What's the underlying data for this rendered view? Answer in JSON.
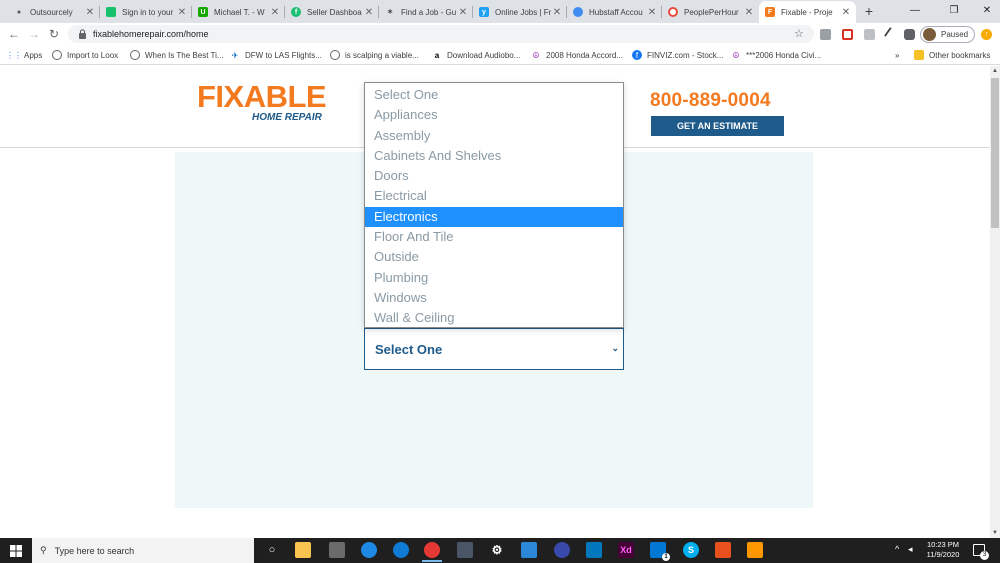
{
  "browser": {
    "tabs": [
      {
        "title": "Outsourcely",
        "icon": "person-icon",
        "color": "#555555"
      },
      {
        "title": "Sign in to your",
        "icon": "green-square-icon",
        "color": "#15c26b"
      },
      {
        "title": "Michael T. - W",
        "icon": "upwork-icon",
        "color": "#14a800"
      },
      {
        "title": "Seller Dashboa",
        "icon": "fiverr-icon",
        "color": "#1dbf73"
      },
      {
        "title": "Find a Job - Gu",
        "icon": "guru-icon",
        "color": "#555555"
      },
      {
        "title": "Online Jobs | Fr",
        "icon": "twitter-bird-icon",
        "color": "#1da1f2"
      },
      {
        "title": "Hubstaff Accou",
        "icon": "hubstaff-icon",
        "color": "#3f8cf2"
      },
      {
        "title": "PeoplePerHour",
        "icon": "pph-icon",
        "color": "#e74c3c"
      },
      {
        "title": "Fixable - Proje",
        "icon": "fixable-icon",
        "color": "#f47a20"
      }
    ],
    "active_tab": 8,
    "address": "fixablehomerepair.com/home",
    "profile_status": "Paused",
    "bookmarks": [
      {
        "label": "Apps",
        "icon": "apps-grid-icon"
      },
      {
        "label": "Import to Loox",
        "icon": "globe-icon"
      },
      {
        "label": "When Is The Best Ti...",
        "icon": "globe-icon"
      },
      {
        "label": "DFW to LAS Flights...",
        "icon": "plane-icon"
      },
      {
        "label": "is scalping a viable...",
        "icon": "globe-icon"
      },
      {
        "label": "Download Audiobo...",
        "icon": "amazon-icon"
      },
      {
        "label": "2008 Honda Accord...",
        "icon": "peace-icon"
      },
      {
        "label": "FINVIZ.com - Stock...",
        "icon": "facebook-icon"
      },
      {
        "label": "***2006 Honda Civi...",
        "icon": "peace-icon"
      }
    ],
    "more_bookmarks": "»",
    "other_bookmarks": "Other bookmarks"
  },
  "site": {
    "logo_word": "FIXABLE",
    "logo_sub": "HOME REPAIR",
    "phone": "800-889-0004",
    "cta_label": "GET AN ESTIMATE",
    "select": {
      "value": "Select One",
      "options": [
        "Select One",
        "Appliances",
        "Assembly",
        "Cabinets And Shelves",
        "Doors",
        "Electrical",
        "Electronics",
        "Floor And Tile",
        "Outside",
        "Plumbing",
        "Windows",
        "Wall & Ceiling"
      ],
      "highlighted": "Electronics"
    }
  },
  "taskbar": {
    "search_placeholder": "Type here to search",
    "time": "10:23 PM",
    "date": "11/9/2020",
    "notification_count": "3",
    "mail_badge": "1",
    "xd_label": "Xd"
  },
  "colors": {
    "brand_orange": "#f47a20",
    "brand_blue": "#1e5a8a",
    "highlight": "#1e90ff"
  }
}
